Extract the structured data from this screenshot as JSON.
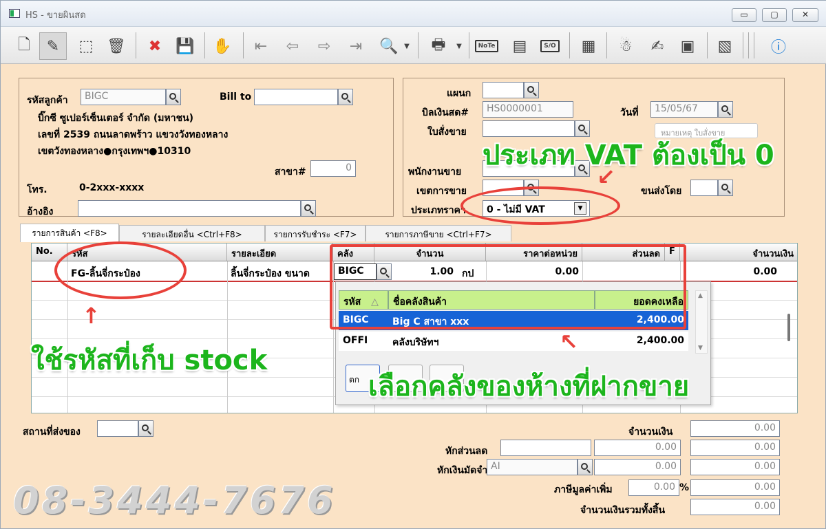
{
  "window": {
    "title": "HS - ขายผินสด",
    "min": "▭",
    "max": "▢",
    "close": "✕"
  },
  "toolbar": {
    "icons": [
      "new-icon",
      "edit-icon",
      "tag-icon",
      "trash-icon",
      "cancel-icon",
      "save-icon",
      "payment-icon",
      "first-icon",
      "prev-icon",
      "next-icon",
      "last-icon",
      "find-icon",
      "print-icon",
      "note-icon",
      "card-icon",
      "so-icon",
      "report-icon",
      "ok-user-icon",
      "ok-pen-icon",
      "ok-doc-icon",
      "form-icon",
      "help-icon"
    ],
    "note_label": "NoTe",
    "so_label": "S/O"
  },
  "customer": {
    "code_label": "รหัสลูกค้า",
    "code": "BIGC",
    "billto_label": "Bill to",
    "billto": "",
    "name": "บิ๊กซี ซูเปอร์เซ็นเตอร์ จำกัด (มหาชน)",
    "addr1": "เลขที่ 2539 ถนนลาดพร้าว แขวงวังทองหลาง",
    "addr2": "เขตวังทองหลาง●กรุงเทพฯ●10310",
    "branch_label": "สาขา#",
    "branch": "0",
    "phone_label": "โทร.",
    "phone": "0-2xxx-xxxx",
    "ref_label": "อ้างอิง",
    "ref": ""
  },
  "doc": {
    "dept_label": "แผนก",
    "dept": "",
    "bill_label": "บิลเงินสด#",
    "bill": "HS0000001",
    "date_label": "วันที่",
    "date": "15/05/67",
    "so_label": "ใบสั่งขาย",
    "so": "",
    "tooltip": "หมายเหตุ ใบสั่งขาย",
    "sales_label": "พนักงานขาย",
    "sales": "",
    "area_label": "เขตการขาย",
    "area": "",
    "ship_label": "ขนส่งโดย",
    "ship": "",
    "vat_label": "ประเภทราคา",
    "vat": "0 - ไม่มี VAT"
  },
  "tabs": [
    "รายการสินค้า <F8>",
    "รายละเอียดอื่น <Ctrl+F8>",
    "รายการรับชำระ <F7>",
    "รายการภาษีขาย <Ctrl+F7>"
  ],
  "grid": {
    "headers": [
      "No.",
      "รหัส",
      "รายละเอียด",
      "คลัง",
      "จำนวน",
      "ราคาต่อหน่วย",
      "ส่วนลด",
      "F",
      "จำนวนเงิน"
    ],
    "row": {
      "code": "FG-ลิ้นจี่กระป๋อง",
      "desc": "ลิ้นจี่กระป๋อง ขนาด",
      "wh": "BIGC",
      "qty": "1.00",
      "unit": "กป",
      "price": "0.00",
      "amount": "0.00"
    }
  },
  "popup": {
    "headers": [
      "รหัส",
      "ชื่อคลังสินค้า",
      "ยอดคงเหลือ"
    ],
    "rows": [
      {
        "code": "BIGC",
        "name": "Big C สาขา xxx",
        "qty": "2,400.00"
      },
      {
        "code": "OFFI",
        "name": "คลังบริษัทฯ",
        "qty": "2,400.00"
      }
    ],
    "btn1": "ตก"
  },
  "footer": {
    "ship_place_label": "สถานที่ส่งของ",
    "amount_label": "จำนวนเงิน",
    "amount": "0.00",
    "discount_label": "หักส่วนลด",
    "discount1": "0.00",
    "discount2": "0.00",
    "deposit_label": "หักเงินมัดจำ",
    "deposit_code": "AI",
    "deposit1": "0.00",
    "deposit2": "0.00",
    "vat_label": "ภาษีมูลค่าเพิ่ม",
    "vat_pct": "0.00",
    "pct": "%",
    "vat_amt": "0.00",
    "total_label": "จำนวนเงินรวมทั้งสิ้น",
    "total": "0.00"
  },
  "annotations": {
    "vat": "ประเภท VAT ต้องเป็น 0",
    "stock": "ใช้รหัสที่เก็บ stock",
    "warehouse": "เลือกคลังของห้างที่ฝากขาย",
    "phone": "08-3444-7676"
  },
  "colors": {
    "panel": "#fbe3c6",
    "annotation_green": "#1cb51c",
    "annotation_red": "#e8413a",
    "selection": "#1763d6",
    "popup_header": "#c8f08c"
  }
}
